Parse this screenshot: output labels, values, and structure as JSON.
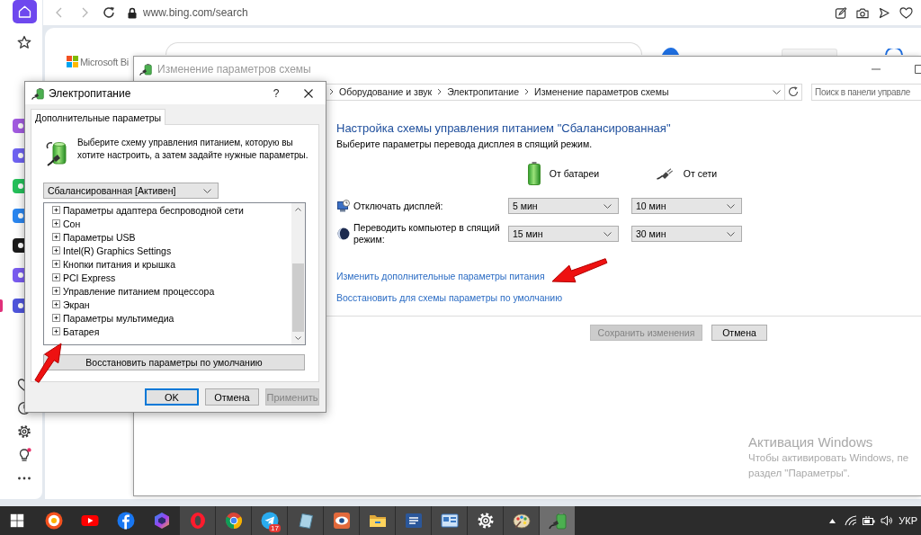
{
  "browser": {
    "url": "www.bing.com/search",
    "sidebar": [
      {
        "kind": "home",
        "selected": true
      },
      {
        "kind": "favorites",
        "selected": false
      },
      {
        "kind": "app",
        "selected": false,
        "active": false,
        "color": "#a25be0"
      },
      {
        "kind": "app",
        "selected": false,
        "active": false,
        "color": "#6f63f2"
      },
      {
        "kind": "app",
        "selected": false,
        "active": false,
        "color": "#25c05a"
      },
      {
        "kind": "app",
        "selected": false,
        "active": false,
        "color": "#2a86f0"
      },
      {
        "kind": "app",
        "selected": false,
        "active": false,
        "color": "#1b1b1b"
      },
      {
        "kind": "app",
        "selected": false,
        "active": false,
        "color": "#7a5cf0"
      },
      {
        "kind": "app",
        "selected": false,
        "active": true,
        "color": "#4f55dc"
      },
      {
        "kind": "likes",
        "selected": false
      },
      {
        "kind": "history",
        "selected": false
      },
      {
        "kind": "settings",
        "selected": false
      },
      {
        "kind": "tips",
        "selected": false,
        "notification": true
      },
      {
        "kind": "more",
        "selected": false
      }
    ],
    "page": {
      "logo_text": "Microsoft Bi"
    }
  },
  "control_panel": {
    "title": "Изменение параметров схемы",
    "focused": false,
    "breadcrumbs": [
      "Оборудование и звук",
      "Электропитание",
      "Изменение параметров схемы"
    ],
    "search": {
      "placeholder": "Поиск в панели управле"
    },
    "heading": "Настройка схемы управления питанием \"Сбалансированная\"",
    "subtitle": "Выберите параметры перевода дисплея в спящий режим.",
    "columns": [
      {
        "kind": "battery",
        "label": "От батареи"
      },
      {
        "kind": "plugged",
        "label": "От сети"
      }
    ],
    "settings": [
      {
        "kind": "display",
        "label": "Отключать дисплей:",
        "values": [
          "5 мин",
          "10 мин"
        ]
      },
      {
        "kind": "sleep",
        "label": "Переводить компьютер в спящий режим:",
        "values": [
          "15 мин",
          "30 мин"
        ]
      }
    ],
    "links": [
      "Изменить дополнительные параметры питания",
      "Восстановить для схемы параметры по умолчанию"
    ],
    "buttons": [
      {
        "label": "Сохранить изменения",
        "disabled": true
      },
      {
        "label": "Отмена",
        "disabled": false
      }
    ]
  },
  "power_dialog": {
    "title": "Электропитание",
    "focused": true,
    "help": "?",
    "tabs": [
      {
        "label": "Дополнительные параметры",
        "selected": true
      }
    ],
    "description": "Выберите схему управления питанием, которую вы хотите настроить, а затем задайте нужные параметры.",
    "scheme": "Сбалансированная [Активен]",
    "tree": [
      {
        "label": "Параметры адаптера беспроводной сети",
        "expanded": false
      },
      {
        "label": "Сон",
        "expanded": false
      },
      {
        "label": "Параметры USB",
        "expanded": false
      },
      {
        "label": "Intel(R) Graphics Settings",
        "expanded": false
      },
      {
        "label": "Кнопки питания и крышка",
        "expanded": false
      },
      {
        "label": "PCI Express",
        "expanded": false
      },
      {
        "label": "Управление питанием процессора",
        "expanded": false
      },
      {
        "label": "Экран",
        "expanded": false
      },
      {
        "label": "Параметры мультимедиа",
        "expanded": false
      },
      {
        "label": "Батарея",
        "expanded": false
      }
    ],
    "restore_button": "Восстановить параметры по умолчанию",
    "buttons": [
      {
        "label": "OK",
        "default": true,
        "disabled": false
      },
      {
        "label": "Отмена",
        "default": false,
        "disabled": false
      },
      {
        "label": "Применить",
        "default": false,
        "disabled": true
      }
    ]
  },
  "activation_notice": {
    "title": "Активация Windows",
    "lines": [
      "Чтобы активировать Windows, пе",
      "раздел \"Параметры\"."
    ]
  },
  "taskbar": {
    "apps": [
      {
        "kind": "start",
        "running": false,
        "active": false
      },
      {
        "kind": "browser",
        "running": false,
        "active": false
      },
      {
        "kind": "video",
        "running": false,
        "active": false
      },
      {
        "kind": "social",
        "running": false,
        "active": false
      },
      {
        "kind": "assistant",
        "running": false,
        "active": false
      },
      {
        "kind": "opera",
        "running": true,
        "active": false
      },
      {
        "kind": "chrome",
        "running": true,
        "active": false
      },
      {
        "kind": "messenger",
        "running": true,
        "active": false,
        "badge": "17"
      },
      {
        "kind": "notes",
        "running": true,
        "active": false
      },
      {
        "kind": "viewer",
        "running": true,
        "active": false
      },
      {
        "kind": "files",
        "running": true,
        "active": false
      },
      {
        "kind": "document",
        "running": true,
        "active": false
      },
      {
        "kind": "system",
        "running": true,
        "active": false
      },
      {
        "kind": "settings",
        "running": true,
        "active": false
      },
      {
        "kind": "paint",
        "running": true,
        "active": false
      },
      {
        "kind": "power",
        "running": true,
        "active": true
      }
    ],
    "language": "УКР"
  }
}
